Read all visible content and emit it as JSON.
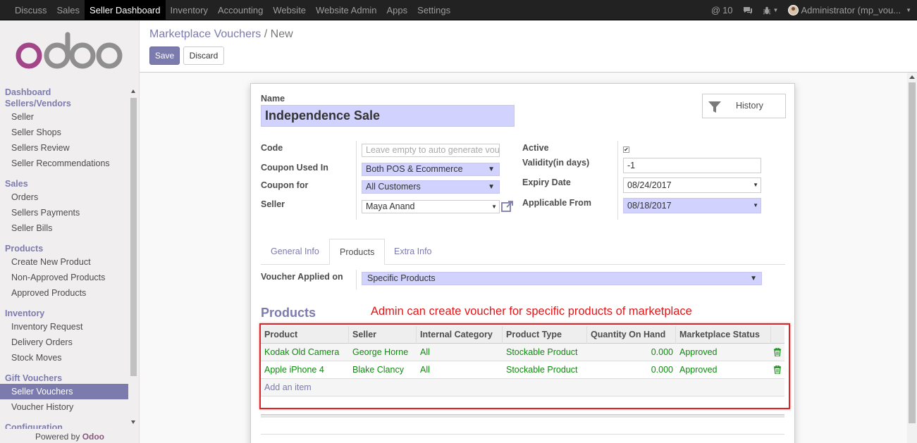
{
  "topbar": {
    "menu": [
      "Discuss",
      "Sales",
      "Seller Dashboard",
      "Inventory",
      "Accounting",
      "Website",
      "Website Admin",
      "Apps",
      "Settings"
    ],
    "active_menu": "Seller Dashboard",
    "messages_count": "10",
    "user": "Administrator (mp_vou..."
  },
  "sidebar": {
    "logo_text": "odoo",
    "sections": [
      {
        "title": "Dashboard",
        "items": []
      },
      {
        "title": "Sellers/Vendors",
        "items": [
          "Seller",
          "Seller Shops",
          "Sellers Review",
          "Seller Recommendations"
        ]
      },
      {
        "title": "Sales",
        "items": [
          "Orders",
          "Sellers Payments",
          "Seller Bills"
        ]
      },
      {
        "title": "Products",
        "items": [
          "Create New Product",
          "Non-Approved Products",
          "Approved Products"
        ]
      },
      {
        "title": "Inventory",
        "items": [
          "Inventory Request",
          "Delivery Orders",
          "Stock Moves"
        ]
      },
      {
        "title": "Gift Vouchers",
        "items": [
          "Seller Vouchers",
          "Voucher History"
        ]
      },
      {
        "title": "Configuration",
        "items": []
      }
    ],
    "active_item": "Seller Vouchers",
    "powered_by": "Powered by",
    "powered_brand": "Odoo"
  },
  "control": {
    "breadcrumb_parent": "Marketplace Vouchers",
    "breadcrumb_sep": "/",
    "breadcrumb_current": "New",
    "save_label": "Save",
    "discard_label": "Discard"
  },
  "form": {
    "name_label": "Name",
    "name_value": "Independence Sale",
    "history_label": "History",
    "code_label": "Code",
    "code_placeholder": "Leave empty to auto generate voucher code",
    "coupon_used_in_label": "Coupon Used In",
    "coupon_used_in_value": "Both POS & Ecommerce",
    "coupon_for_label": "Coupon for",
    "coupon_for_value": "All Customers",
    "seller_label": "Seller",
    "seller_value": "Maya Anand",
    "active_label": "Active",
    "active_checked": "✔",
    "validity_label": "Validity(in days)",
    "validity_value": "-1",
    "expiry_label": "Expiry Date",
    "expiry_value": "08/24/2017",
    "applicable_label": "Applicable From",
    "applicable_value": "08/18/2017",
    "tabs": [
      "General Info",
      "Products",
      "Extra Info"
    ],
    "active_tab": "Products",
    "voucher_applied_label": "Voucher Applied on",
    "voucher_applied_value": "Specific Products",
    "products_title": "Products",
    "annotation": "Admin can create voucher for specific products of marketplace"
  },
  "table": {
    "headers": [
      "Product",
      "Seller",
      "Internal Category",
      "Product Type",
      "Quantity On Hand",
      "Marketplace Status"
    ],
    "rows": [
      [
        "Kodak Old Camera",
        "George Horne",
        "All",
        "Stockable Product",
        "0.000",
        "Approved"
      ],
      [
        "Apple iPhone 4",
        "Blake Clancy",
        "All",
        "Stockable Product",
        "0.000",
        "Approved"
      ]
    ],
    "add_item": "Add an item"
  },
  "colors": {
    "brand": "#7c7bad",
    "odoo_logo": "#875a7b",
    "required_field": "#d2d2ff",
    "row_text": "#0d8b0d",
    "annotation": "#e0171a"
  }
}
